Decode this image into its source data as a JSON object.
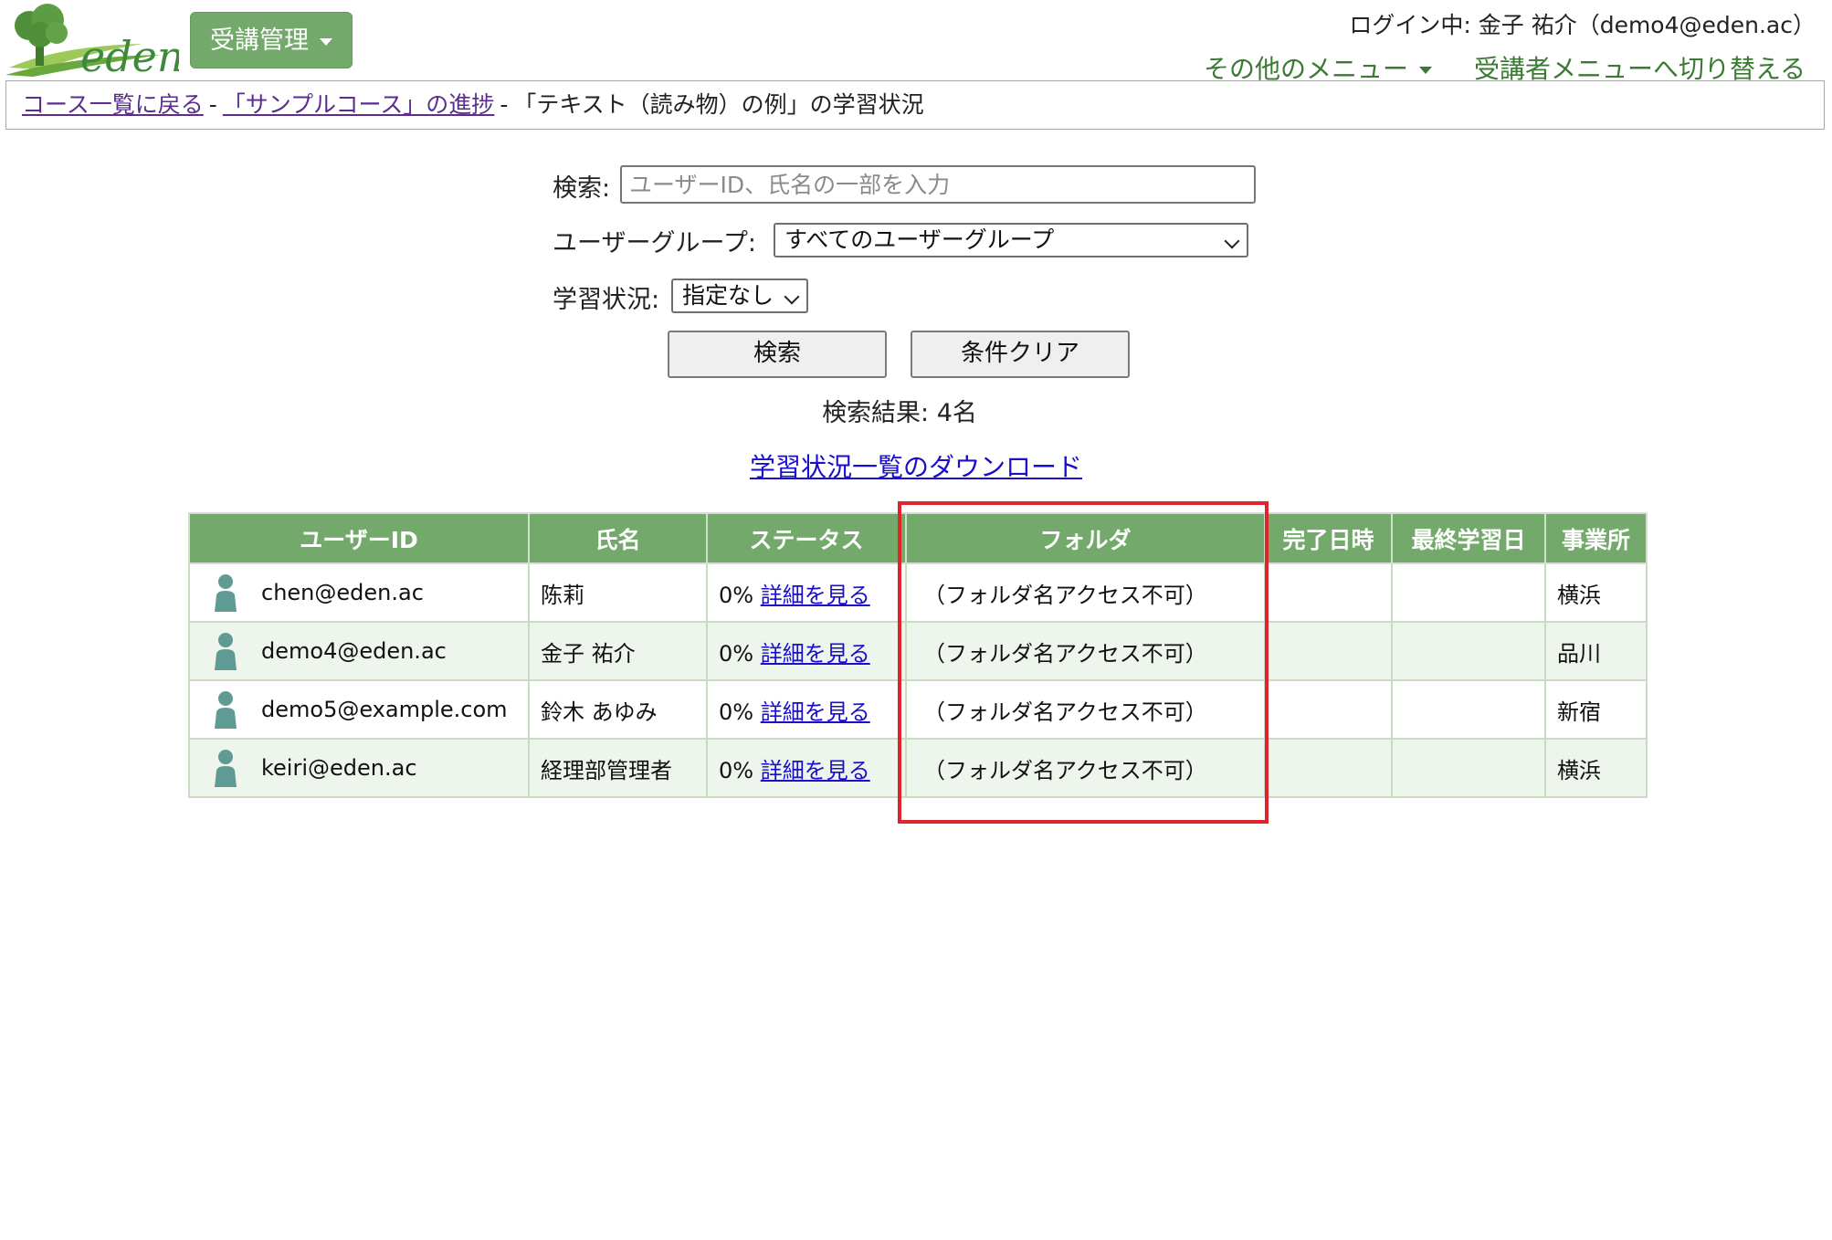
{
  "header": {
    "logo_text": "eden",
    "menu_button_label": "受講管理",
    "login_info": "ログイン中: 金子 祐介（demo4@eden.ac）",
    "other_menu_label": "その他のメニュー",
    "switch_menu_label": "受講者メニューへ切り替える"
  },
  "breadcrumb": {
    "back_to_courses": "コース一覧に戻る",
    "separator": "-",
    "course_progress": "「サンプルコース」の進捗",
    "current": "「テキスト（読み物）の例」の学習状況"
  },
  "search": {
    "search_label": "検索:",
    "search_placeholder": "ユーザーID、氏名の一部を入力",
    "search_value": "",
    "user_group_label": "ユーザーグループ:",
    "user_group_value": "すべてのユーザーグループ",
    "status_label": "学習状況:",
    "status_value": "指定なし",
    "search_button": "検索",
    "clear_button": "条件クリア",
    "result_count": "検索結果: 4名",
    "download_link": "学習状況一覧のダウンロード"
  },
  "table": {
    "headers": [
      "ユーザーID",
      "氏名",
      "ステータス",
      "フォルダ",
      "完了日時",
      "最終学習日",
      "事業所"
    ],
    "rows": [
      {
        "user_id": "chen@eden.ac",
        "name": "陈莉",
        "status": "0%",
        "detail": "詳細を見る",
        "folder": "（フォルダ名アクセス不可）",
        "completed": "",
        "last_study": "",
        "office": "横浜"
      },
      {
        "user_id": "demo4@eden.ac",
        "name": "金子 祐介",
        "status": "0%",
        "detail": "詳細を見る",
        "folder": "（フォルダ名アクセス不可）",
        "completed": "",
        "last_study": "",
        "office": "品川"
      },
      {
        "user_id": "demo5@example.com",
        "name": "鈴木 あゆみ",
        "status": "0%",
        "detail": "詳細を見る",
        "folder": "（フォルダ名アクセス不可）",
        "completed": "",
        "last_study": "",
        "office": "新宿"
      },
      {
        "user_id": "keiri@eden.ac",
        "name": "経理部管理者",
        "status": "0%",
        "detail": "詳細を見る",
        "folder": "（フォルダ名アクセス不可）",
        "completed": "",
        "last_study": "",
        "office": "横浜"
      }
    ]
  },
  "colors": {
    "brand_green": "#73aa6b",
    "link_blue": "#1a0dcc",
    "visited_purple": "#5a2d8e",
    "highlight_red": "#e0242b",
    "person_icon": "#5f9a94"
  },
  "icons": {
    "logo": "tree-logo-icon",
    "menu_caret": "caret-down-icon",
    "user": "person-icon"
  }
}
